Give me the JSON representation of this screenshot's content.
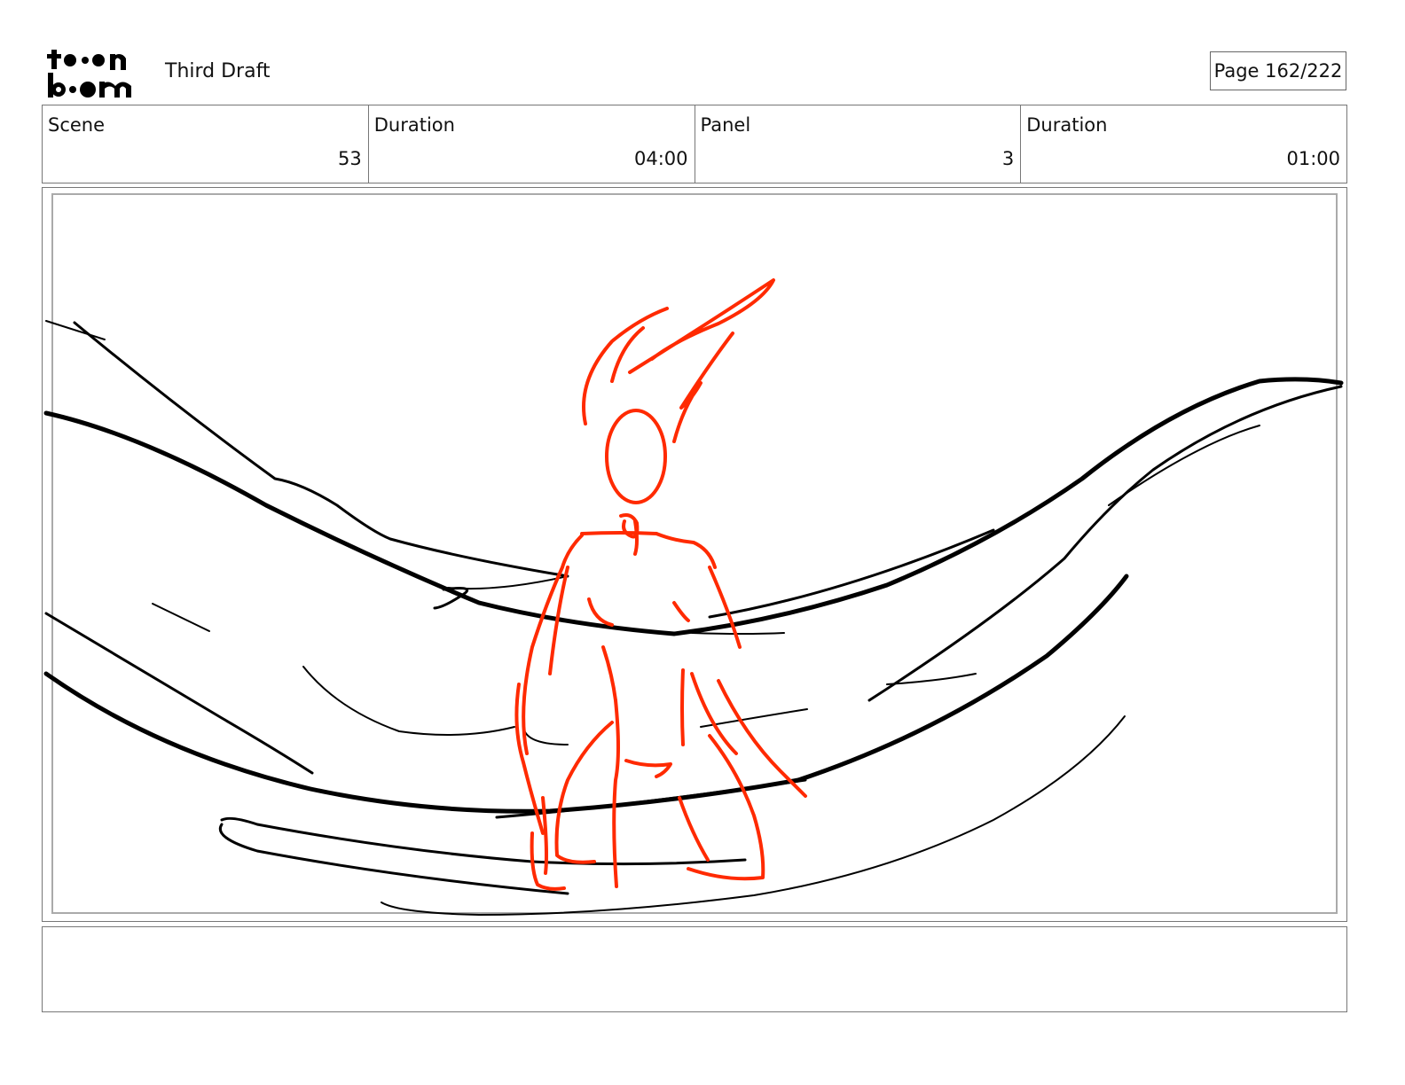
{
  "header": {
    "logo": {
      "top_word": "toon",
      "bottom_word": "boom",
      "icon": "toon-boom-logo"
    },
    "title": "Third Draft",
    "page_label": "Page 162/222"
  },
  "info": [
    {
      "label": "Scene",
      "value": "53"
    },
    {
      "label": "Duration",
      "value": "04:00"
    },
    {
      "label": "Panel",
      "value": "3"
    },
    {
      "label": "Duration",
      "value": "01:00"
    }
  ],
  "panel": {
    "description": "",
    "stroke_colors": {
      "environment": "#000000",
      "figure": "#ff2a00"
    }
  },
  "notes": ""
}
